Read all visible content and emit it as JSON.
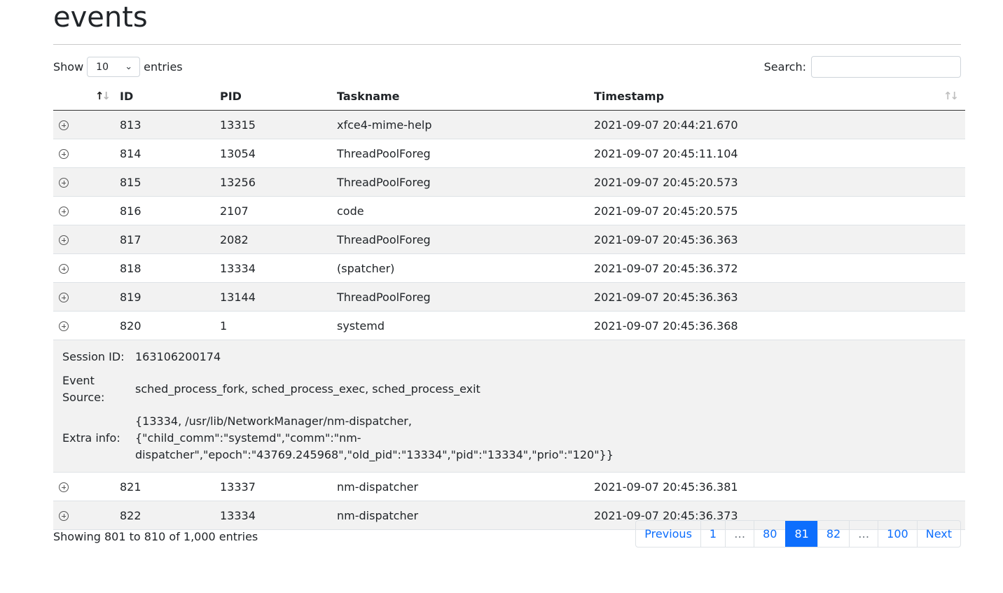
{
  "page": {
    "title": "events"
  },
  "length_control": {
    "show_label": "Show",
    "selected": "10",
    "entries_label": "entries"
  },
  "search": {
    "label": "Search:",
    "value": ""
  },
  "table": {
    "columns": [
      "",
      "ID",
      "PID",
      "Taskname",
      "Timestamp"
    ],
    "rows": [
      {
        "id": "813",
        "pid": "13315",
        "taskname": "xfce4-mime-help",
        "timestamp": "2021-09-07 20:44:21.670"
      },
      {
        "id": "814",
        "pid": "13054",
        "taskname": "ThreadPoolForeg",
        "timestamp": "2021-09-07 20:45:11.104"
      },
      {
        "id": "815",
        "pid": "13256",
        "taskname": "ThreadPoolForeg",
        "timestamp": "2021-09-07 20:45:20.573"
      },
      {
        "id": "816",
        "pid": "2107",
        "taskname": "code",
        "timestamp": "2021-09-07 20:45:20.575"
      },
      {
        "id": "817",
        "pid": "2082",
        "taskname": "ThreadPoolForeg",
        "timestamp": "2021-09-07 20:45:36.363"
      },
      {
        "id": "818",
        "pid": "13334",
        "taskname": "(spatcher)",
        "timestamp": "2021-09-07 20:45:36.372"
      },
      {
        "id": "819",
        "pid": "13144",
        "taskname": "ThreadPoolForeg",
        "timestamp": "2021-09-07 20:45:36.363"
      },
      {
        "id": "820",
        "pid": "1",
        "taskname": "systemd",
        "timestamp": "2021-09-07 20:45:36.368"
      },
      {
        "id": "821",
        "pid": "13337",
        "taskname": "nm-dispatcher",
        "timestamp": "2021-09-07 20:45:36.381"
      },
      {
        "id": "822",
        "pid": "13334",
        "taskname": "nm-dispatcher",
        "timestamp": "2021-09-07 20:45:36.373"
      }
    ],
    "expanded_detail": {
      "session_id_label": "Session ID:",
      "session_id": "163106200174",
      "event_source_label": "Event Source:",
      "event_source": "sched_process_fork, sched_process_exec, sched_process_exit",
      "extra_info_label": "Extra info:",
      "extra_info": "{13334, /usr/lib/NetworkManager/nm-dispatcher, {\"child_comm\":\"systemd\",\"comm\":\"nm-dispatcher\",\"epoch\":\"43769.245968\",\"old_pid\":\"13334\",\"pid\":\"13334\",\"prio\":\"120\"}}"
    }
  },
  "info": "Showing 801 to 810 of 1,000 entries",
  "pagination": {
    "previous": "Previous",
    "p1": "1",
    "ellipsis1": "…",
    "p80": "80",
    "p81": "81",
    "p82": "82",
    "ellipsis2": "…",
    "p100": "100",
    "next": "Next",
    "active_page": "81"
  },
  "colors": {
    "accent": "#0d6efd",
    "stripe": "#f2f2f2"
  }
}
